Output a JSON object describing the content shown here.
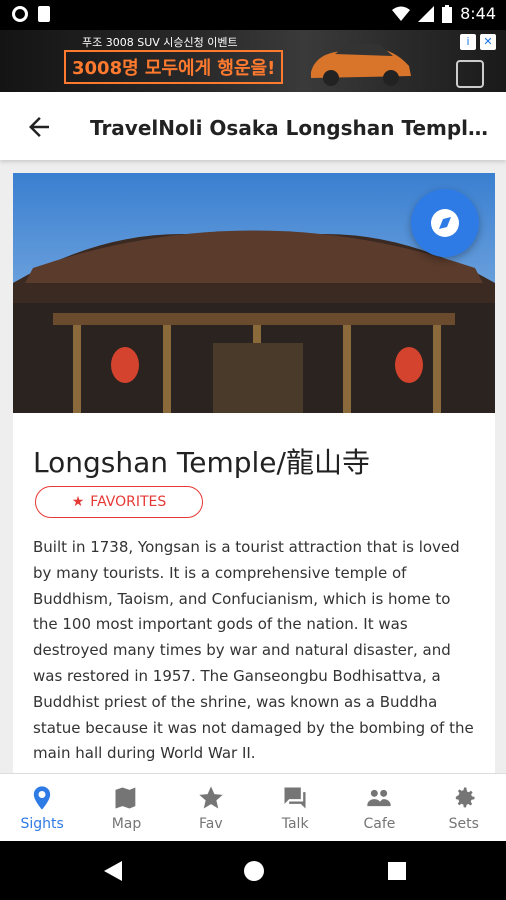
{
  "status_bar": {
    "time": "8:44"
  },
  "ad": {
    "top_text": "푸조 3008 SUV 시승신청 이벤트",
    "main_text": "3008명 모두에게 행운을!",
    "choices_icon": "i",
    "close_icon": "✕"
  },
  "appbar": {
    "title": "TravelNoli Osaka Longshan Temple/龍山寺"
  },
  "place": {
    "title": "Longshan Temple/龍山寺",
    "favorites_label": "FAVORITES",
    "description": "Built in 1738, Yongsan is a tourist attraction that is loved by many tourists. It is a comprehensive temple of Buddhism, Taoism, and Confucianism, which is home to the 100 most important gods of the nation. It was destroyed many times by war and natural disaster, and was restored in 1957. The Ganseongbu Bodhisattva, a Buddhist priest of the shrine, was known as a Buddha statue because it was not damaged by the bombing of the main hall during World War II."
  },
  "bottom_nav": [
    {
      "label": "Sights",
      "icon": "location-pin-icon"
    },
    {
      "label": "Map",
      "icon": "map-icon"
    },
    {
      "label": "Fav",
      "icon": "star-icon"
    },
    {
      "label": "Talk",
      "icon": "chat-icon"
    },
    {
      "label": "Cafe",
      "icon": "people-icon"
    },
    {
      "label": "Sets",
      "icon": "gear-icon"
    }
  ],
  "colors": {
    "accent": "#2f7be5",
    "favorite": "#e53935"
  }
}
